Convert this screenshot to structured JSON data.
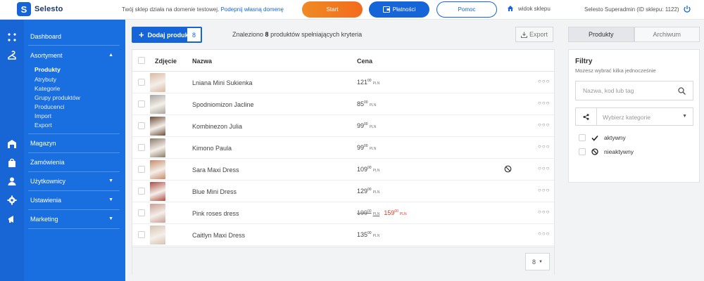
{
  "app": {
    "logo_text": "Selesto"
  },
  "topbar": {
    "notice": "Twój sklep działa na domenie testowej.",
    "notice_link": "Podepnij własną domenę",
    "start_label": "Start",
    "payments_label": "Płatności",
    "help_label": "Pomoc",
    "shop_view_label": "widok sklepu",
    "user_info": "Selesto Superadmin (ID sklepu: 1122)"
  },
  "sidebar": {
    "dashboard": "Dashboard",
    "assortment": "Asortyment",
    "assortment_sub": [
      "Produkty",
      "Atrybuty",
      "Kategorie",
      "Grupy produktów",
      "Producenci",
      "Import",
      "Export"
    ],
    "warehouse": "Magazyn",
    "orders": "Zamówienia",
    "users": "Użytkownicy",
    "settings": "Ustawienia",
    "marketing": "Marketing"
  },
  "toolbar": {
    "add_product_label": "Dodaj produkt",
    "product_count": "8",
    "found_prefix": "Znaleziono",
    "found_count": "8",
    "found_suffix": "produktów spełniających kryteria",
    "export_label": "Export"
  },
  "table": {
    "headers": {
      "photo": "Zdjęcie",
      "name": "Nazwa",
      "price": "Cena"
    },
    "rows": [
      {
        "name": "Lniana Mini Sukienka",
        "price_int": "121",
        "price_dec": "00",
        "currency": "PLN",
        "thumb_color": "#d9b9a4",
        "inactive": false
      },
      {
        "name": "Spodniomizon Jacline",
        "price_int": "85",
        "price_dec": "00",
        "currency": "PLN",
        "thumb_color": "#a8a49e",
        "inactive": false
      },
      {
        "name": "Kombinezon Julia",
        "price_int": "99",
        "price_dec": "00",
        "currency": "PLN",
        "thumb_color": "#6b4d3a",
        "inactive": false
      },
      {
        "name": "Kimono Paula",
        "price_int": "99",
        "price_dec": "00",
        "currency": "PLN",
        "thumb_color": "#8c7b68",
        "inactive": false
      },
      {
        "name": "Sara Maxi Dress",
        "price_int": "109",
        "price_dec": "00",
        "currency": "PLN",
        "thumb_color": "#c98a67",
        "inactive": true
      },
      {
        "name": "Blue Mini Dress",
        "price_int": "129",
        "price_dec": "00",
        "currency": "PLN",
        "thumb_color": "#b04a44",
        "inactive": false
      },
      {
        "name": "Pink roses dress",
        "price_int": "199",
        "price_dec": "00",
        "currency": "PLN",
        "sale_int": "159",
        "sale_dec": "00",
        "thumb_color": "#c99d92",
        "inactive": false
      },
      {
        "name": "Caitlyn Maxi Dress",
        "price_int": "135",
        "price_dec": "00",
        "currency": "PLN",
        "thumb_color": "#d7c3b2",
        "inactive": false
      }
    ],
    "per_page": "8"
  },
  "filters": {
    "tab_products": "Produkty",
    "tab_archive": "Archiwum",
    "title": "Filtry",
    "subtitle": "Możesz wybrać kilka jednocześnie",
    "search_placeholder": "Nazwa, kod lub tag",
    "category_placeholder": "Wybierz kategorie",
    "active_label": "aktywny",
    "inactive_label": "nieaktywny"
  },
  "colors": {
    "primary": "#1565d8",
    "start_orange": "#f2771f",
    "sale_red": "#d93a2b"
  }
}
